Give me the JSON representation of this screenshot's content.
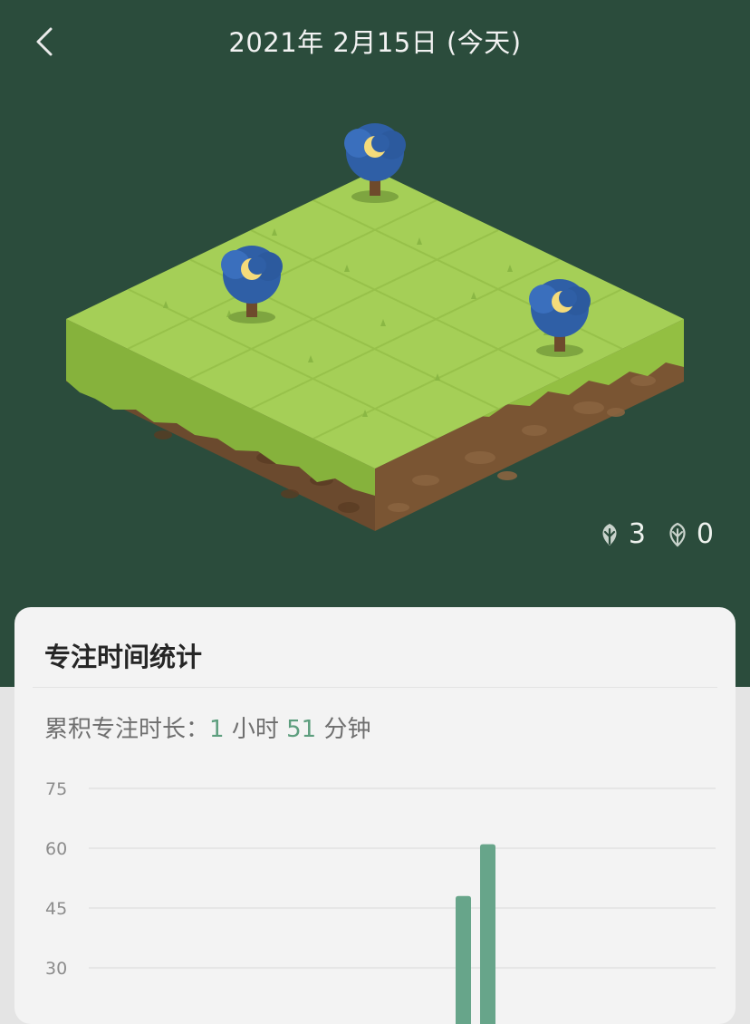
{
  "header": {
    "title": "2021年 2月15日 (今天)"
  },
  "counts": {
    "healthy_trees": "3",
    "withered_trees": "0"
  },
  "stats": {
    "title": "专注时间统计",
    "cumulative_label": "累积专注时长：",
    "hours": "1",
    "hours_unit": "小时",
    "minutes": "51",
    "minutes_unit": "分钟"
  },
  "colors": {
    "accent": "#5d9e7e",
    "background_dark": "#2b4c3c",
    "bar": "#67a58a"
  },
  "chart_data": {
    "type": "bar",
    "y_ticks": [
      75,
      60,
      45,
      30
    ],
    "ylim": [
      0,
      75
    ],
    "bars": [
      {
        "value": 48
      },
      {
        "value": 61
      }
    ],
    "grid": true
  }
}
